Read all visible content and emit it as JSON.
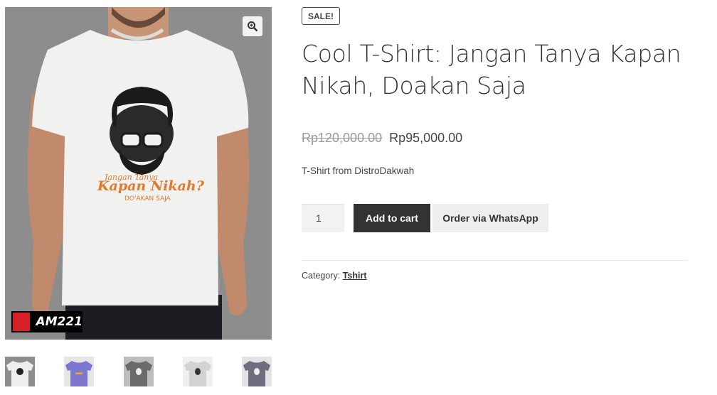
{
  "product": {
    "badge": "SALE!",
    "title": "Cool T-Shirt: Jangan Tanya Kapan Nikah, Doakan Saja",
    "regular_price": "Rp120,000.00",
    "sale_price": "Rp95,000.00",
    "short_description": "T-Shirt from DistroDakwah",
    "quantity": "1",
    "add_to_cart_label": "Add to cart",
    "whatsapp_label": "Order via WhatsApp",
    "category_label": "Category:",
    "category_link": "Tshirt"
  },
  "gallery": {
    "zoom_icon": "magnifier-zoom-icon",
    "shirt_print_line1": "Jangan Tanya",
    "shirt_print_line2": "Kapan Nikah?",
    "shirt_print_line3": "DO'AKAN SAJA",
    "watermark_text": "AM221",
    "thumbnails": [
      {
        "shirt_color": "#eeeeee"
      },
      {
        "shirt_color": "#7d77cf"
      },
      {
        "shirt_color": "#6b6b6b"
      },
      {
        "shirt_color": "#d2d2d2"
      },
      {
        "shirt_color": "#6e6e80"
      }
    ]
  },
  "colors": {
    "sale_price_accent": "#43454b",
    "button_primary": "#333333",
    "button_secondary": "#eeeeee",
    "print_orange": "#e07a2d"
  }
}
